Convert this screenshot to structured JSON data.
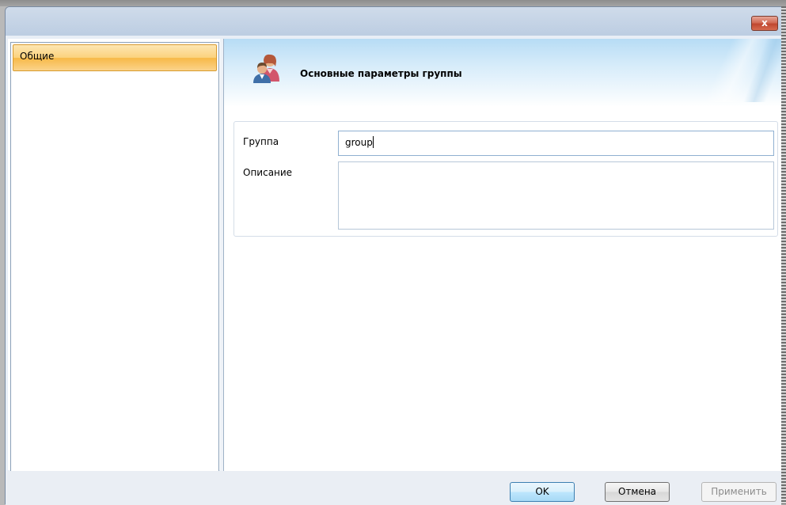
{
  "window": {
    "close_label": "x"
  },
  "sidebar": {
    "items": [
      {
        "label": "Общие",
        "selected": true
      }
    ]
  },
  "header": {
    "title": "Основные параметры группы",
    "icon": "user-group-icon"
  },
  "form": {
    "group_label": "Группа",
    "group_value": "group",
    "description_label": "Описание",
    "description_value": ""
  },
  "buttons": {
    "ok": "OK",
    "cancel": "Отмена",
    "apply": "Применить"
  },
  "colors": {
    "selection": "#fbd27c",
    "accent": "#3c7fb1"
  }
}
